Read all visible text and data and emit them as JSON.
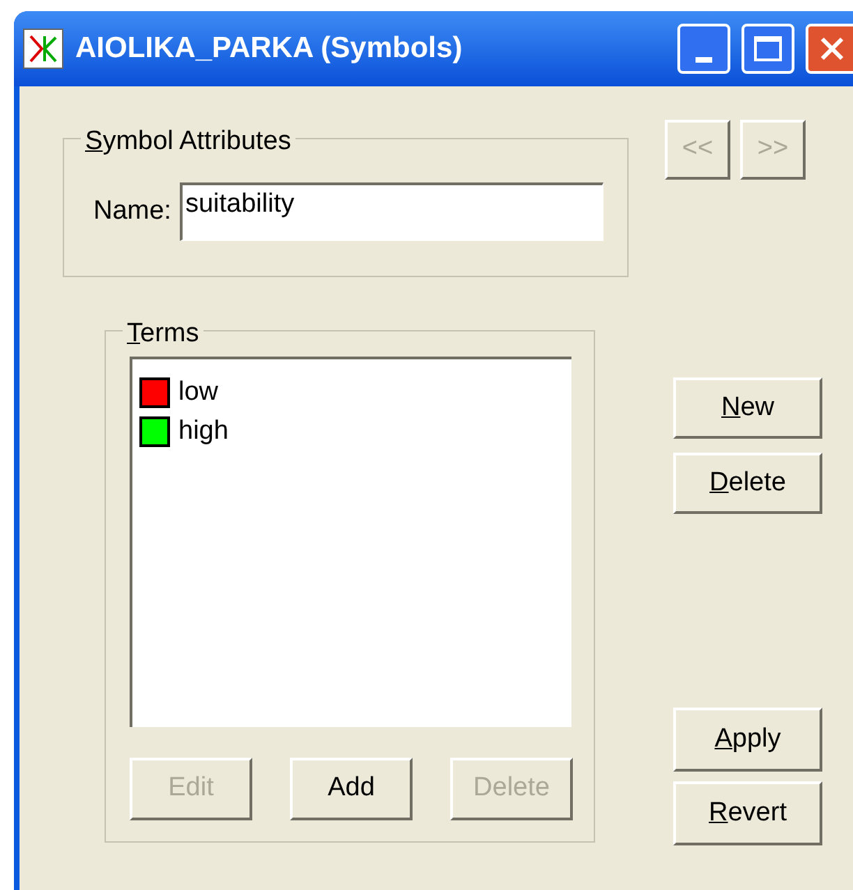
{
  "window": {
    "title": "AIOLIKA_PARKA (Symbols)"
  },
  "symbol_attributes": {
    "legend": "Symbol Attributes",
    "legend_key_underlined": true,
    "name_label": "Name:",
    "name_value": "suitability"
  },
  "nav_buttons": [
    {
      "label": "<<",
      "disabled": true
    },
    {
      "label": ">>",
      "disabled": true
    }
  ],
  "terms": {
    "legend": "Terms",
    "legend_key_underlined": true,
    "items": [
      {
        "label": "low",
        "color": "#ff0000"
      },
      {
        "label": "high",
        "color": "#00ff00"
      }
    ],
    "buttons": [
      {
        "label": "Edit",
        "disabled": true
      },
      {
        "label": "Add",
        "disabled": false
      },
      {
        "label": "Delete",
        "disabled": true
      }
    ]
  },
  "side_buttons": [
    {
      "label": "New",
      "key_underlined": true
    },
    {
      "label": "Delete",
      "key_underlined": true
    }
  ],
  "bottom_buttons": [
    {
      "label": "Apply",
      "key_underlined": true
    },
    {
      "label": "Revert",
      "key_underlined": true
    }
  ]
}
